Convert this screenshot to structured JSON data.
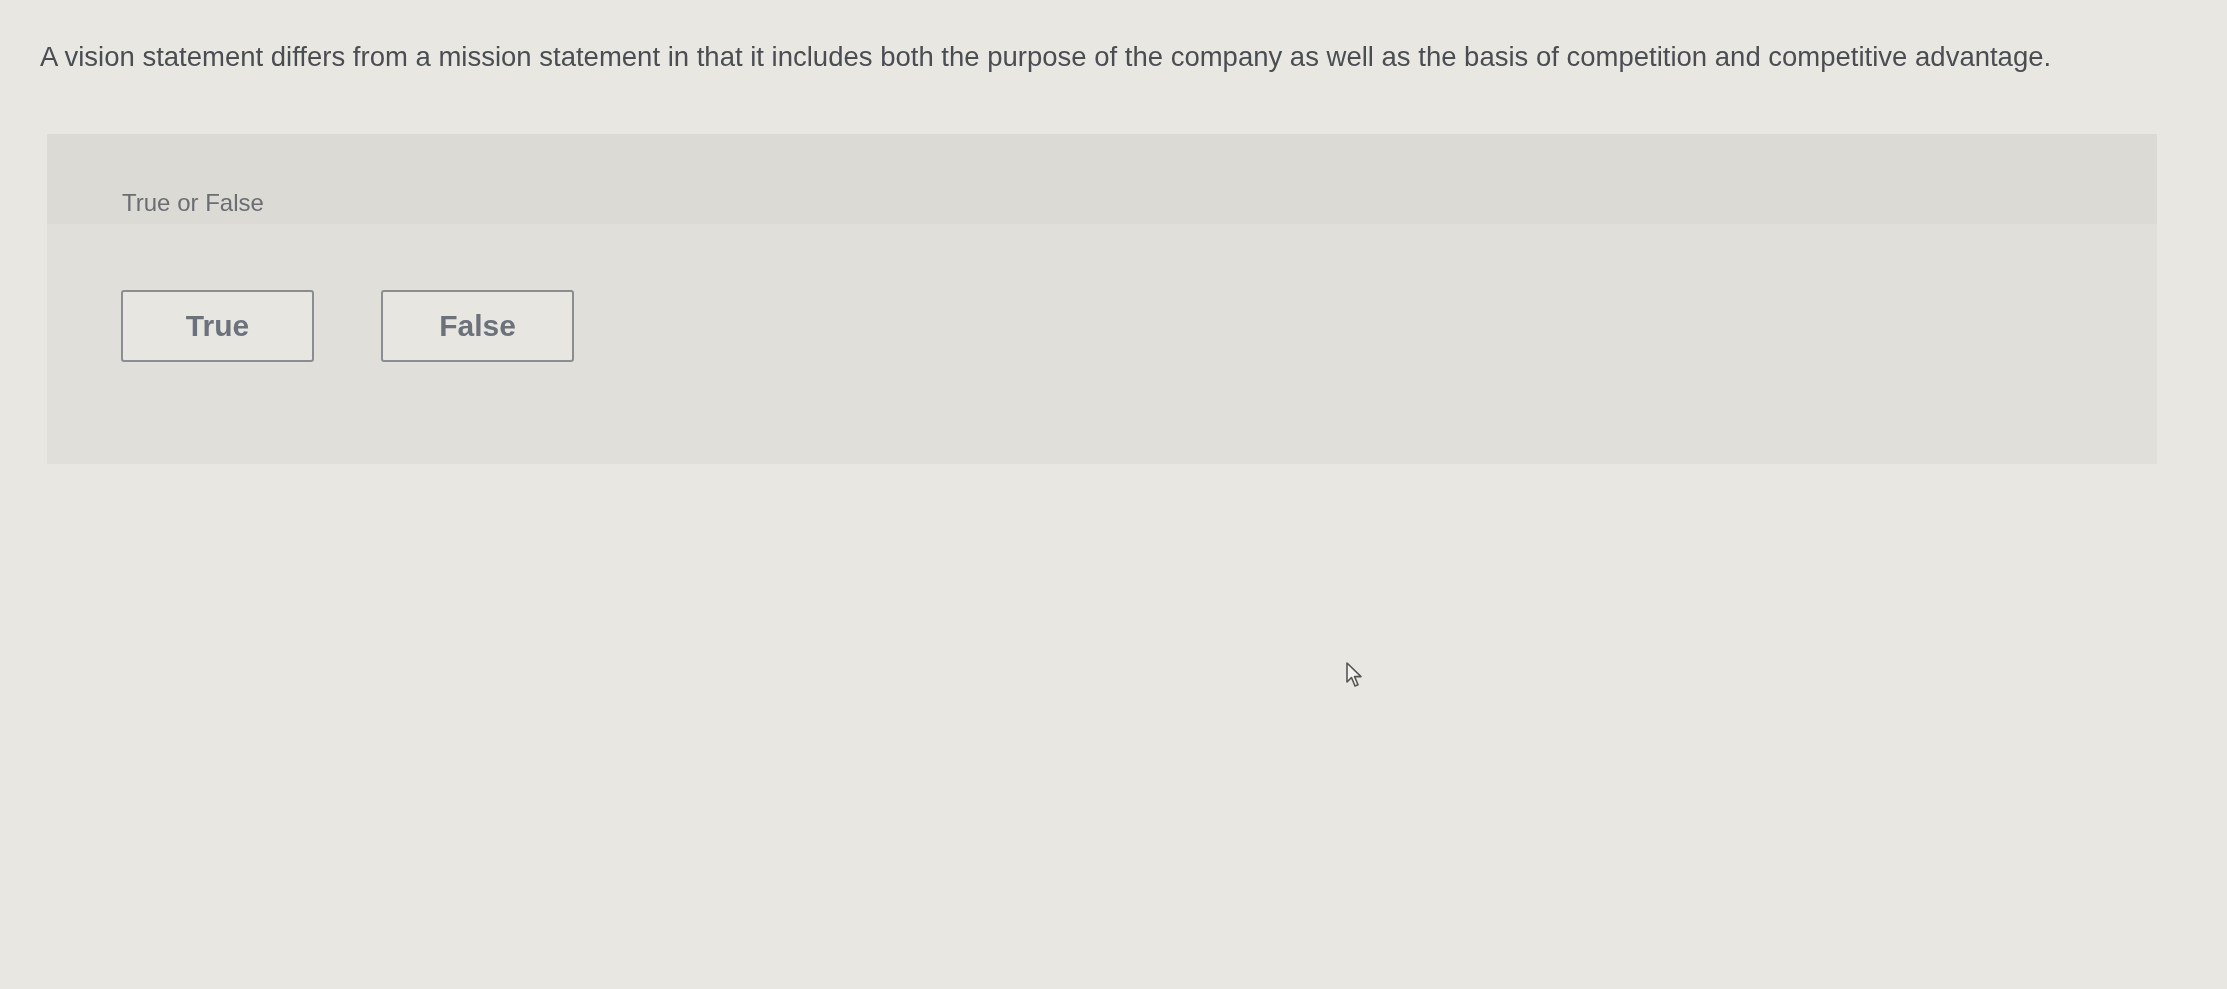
{
  "question": {
    "text": "A vision statement differs from a mission statement in that it includes both the purpose of the company as well as the basis of competition and competitive advantage."
  },
  "answer_panel": {
    "prompt": "True or False",
    "options": [
      {
        "label": "True",
        "selected": false
      },
      {
        "label": "False",
        "selected": false
      }
    ]
  }
}
